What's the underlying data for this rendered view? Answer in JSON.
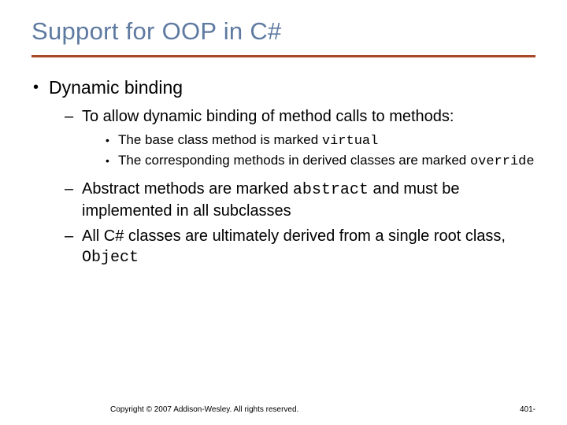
{
  "title": "Support for OOP in C#",
  "l1": {
    "text": "Dynamic binding"
  },
  "l2a": {
    "text": "To allow dynamic binding of method calls to methods:"
  },
  "l3a": {
    "pre": "The base class method is marked ",
    "code": "virtual"
  },
  "l3b": {
    "pre": "The corresponding methods in derived classes are marked ",
    "code": "override"
  },
  "l2b": {
    "pre": "Abstract methods are marked ",
    "code": "abstract",
    "post": " and must be implemented in all subclasses"
  },
  "l2c": {
    "pre": "All C# classes are ultimately derived from a single root class, ",
    "code": "Object"
  },
  "footer": {
    "copyright": "Copyright © 2007 Addison-Wesley. All rights reserved.",
    "page": "401-"
  }
}
